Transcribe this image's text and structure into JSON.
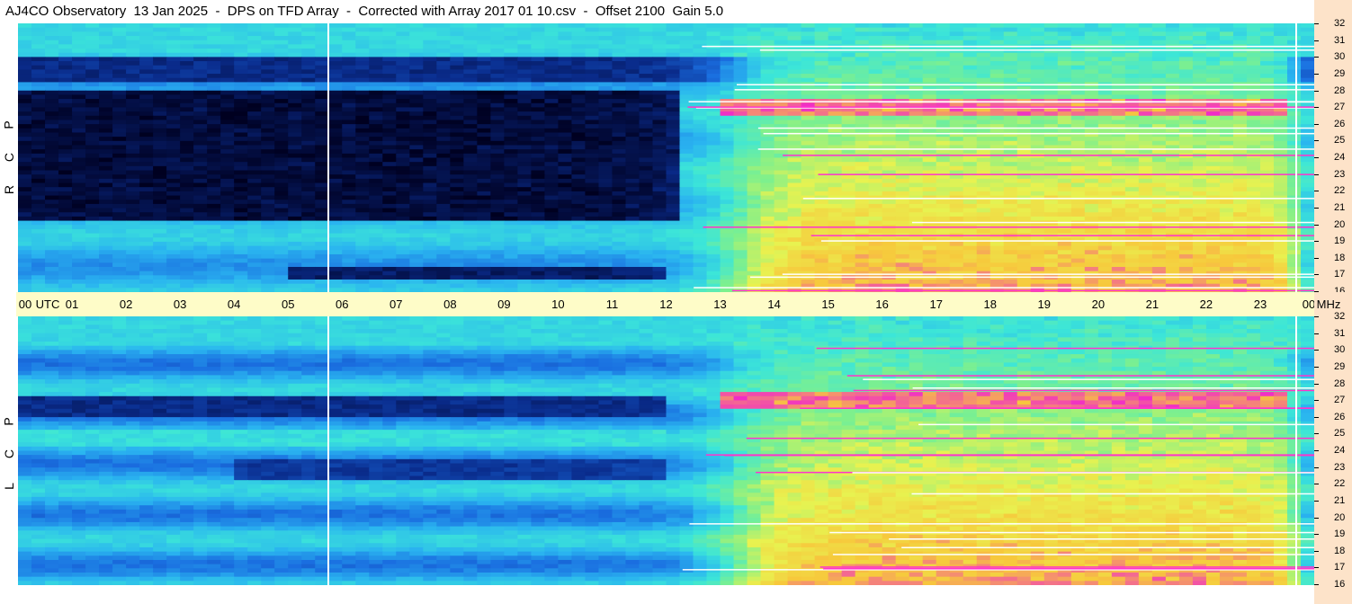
{
  "title": "AJ4CO Observatory  13 Jan 2025  -  DPS on TFD Array  -  Corrected with Array 2017 01 10.csv  -  Offset 2100  Gain 5.0",
  "panels": [
    {
      "name": "rcp",
      "label_letters": [
        "P",
        "C",
        "R"
      ]
    },
    {
      "name": "lcp",
      "label_letters": [
        "P",
        "C",
        "L"
      ]
    }
  ],
  "chart_data": {
    "type": "heatmap",
    "x_ticks": [
      "00",
      "01",
      "02",
      "03",
      "04",
      "05",
      "06",
      "07",
      "08",
      "09",
      "10",
      "11",
      "12",
      "13",
      "14",
      "15",
      "16",
      "17",
      "18",
      "19",
      "20",
      "21",
      "22",
      "23",
      "00"
    ],
    "x_unit": "UTC",
    "xlim": [
      0,
      24
    ],
    "y_ticks": [
      "32",
      "31",
      "30",
      "29",
      "28",
      "27",
      "26",
      "25",
      "24",
      "23",
      "22",
      "21",
      "20",
      "19",
      "18",
      "17",
      "16"
    ],
    "y_unit": "MHz",
    "ylim": [
      16,
      32
    ],
    "colormap": [
      "#000020",
      "#0a2c8c",
      "#1a6ee0",
      "#2ab4f0",
      "#3ce6d8",
      "#7ff08c",
      "#e8f250",
      "#f7c83c",
      "#f02cc8",
      "#ffffff"
    ],
    "markers_utc": [
      5.73,
      23.65
    ]
  }
}
